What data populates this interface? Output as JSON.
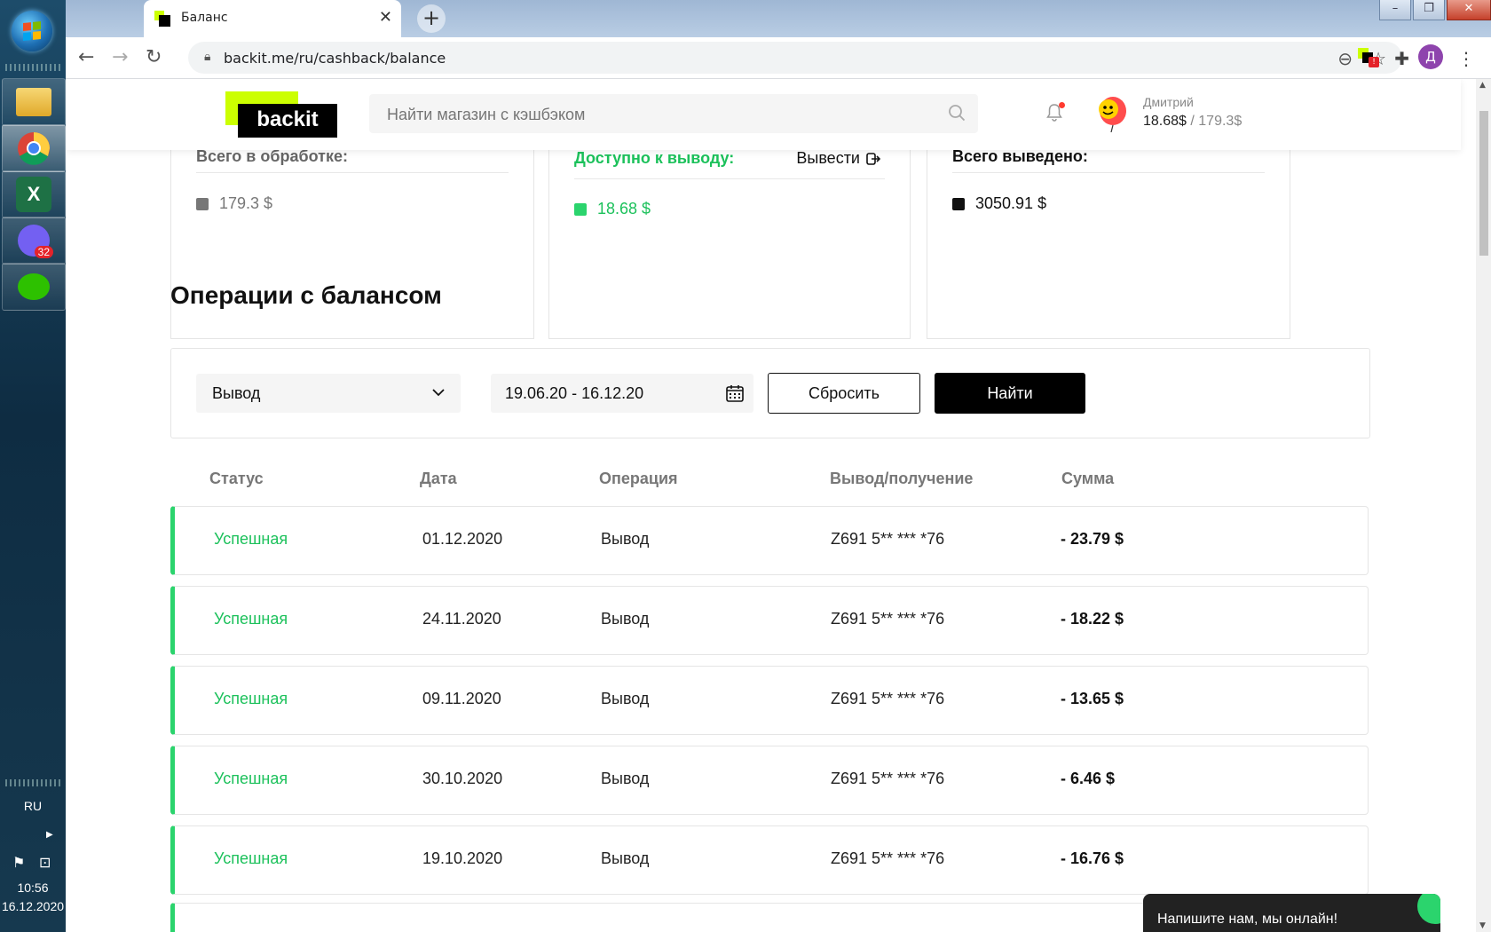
{
  "taskbar": {
    "language": "RU",
    "time": "10:56",
    "date": "16.12.2020",
    "viber_badge": "32"
  },
  "browser": {
    "tab_title": "Баланс",
    "url": "backit.me/ru/cashback/balance",
    "profile_initial": "Д",
    "extension_badge": "!"
  },
  "header": {
    "logo_text": "backit",
    "search_placeholder": "Найти магазин с кэшбэком",
    "user_name": "Дмитрий",
    "user_available": "18.68$",
    "user_separator": " / ",
    "user_pending": "179.3$"
  },
  "cards": {
    "processing": {
      "title": "Всего в обработке:",
      "value": "179.3 $"
    },
    "available": {
      "title": "Доступно к выводу:",
      "value": "18.68 $",
      "action": "Вывести"
    },
    "withdrawn": {
      "title": "Всего выведено:",
      "value": "3050.91 $"
    }
  },
  "operations": {
    "title": "Операции с балансом",
    "filter_type": "Вывод",
    "date_range": "19.06.20 - 16.12.20",
    "reset_label": "Сбросить",
    "find_label": "Найти",
    "columns": [
      "Статус",
      "Дата",
      "Операция",
      "Вывод/получение",
      "Сумма"
    ],
    "rows": [
      {
        "status": "Успешная",
        "date": "01.12.2020",
        "operation": "Вывод",
        "account": "Z691 5** *** *76",
        "sum": "- 23.79 $"
      },
      {
        "status": "Успешная",
        "date": "24.11.2020",
        "operation": "Вывод",
        "account": "Z691 5** *** *76",
        "sum": "- 18.22 $"
      },
      {
        "status": "Успешная",
        "date": "09.11.2020",
        "operation": "Вывод",
        "account": "Z691 5** *** *76",
        "sum": "- 13.65 $"
      },
      {
        "status": "Успешная",
        "date": "30.10.2020",
        "operation": "Вывод",
        "account": "Z691 5** *** *76",
        "sum": "- 6.46 $"
      },
      {
        "status": "Успешная",
        "date": "19.10.2020",
        "operation": "Вывод",
        "account": "Z691 5** *** *76",
        "sum": "- 16.76 $"
      }
    ]
  },
  "chat": {
    "label": "Напишите нам, мы онлайн!"
  },
  "colors": {
    "accent_green": "#2bd46d",
    "brand_lime": "#ccff00",
    "status_green": "#1cc15b"
  }
}
